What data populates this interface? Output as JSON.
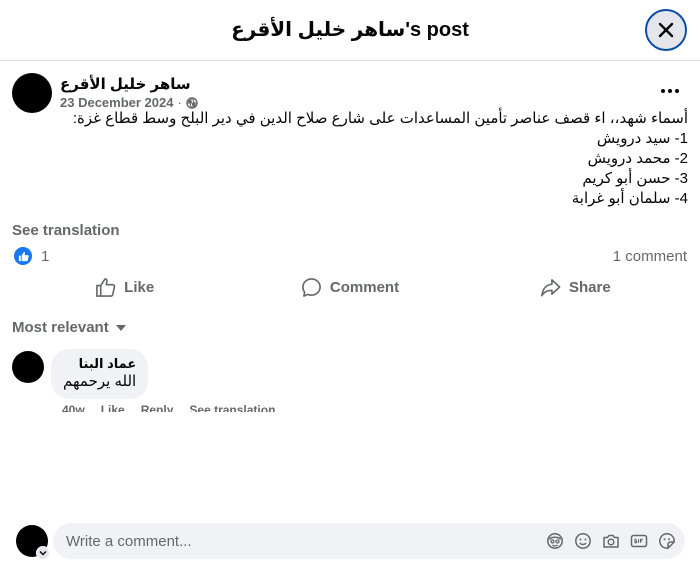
{
  "header": {
    "title": "ساهر خليل الأقرع's post"
  },
  "post": {
    "author": "ساهر خليل الأقرع",
    "date": "23 December 2024",
    "date_separator": "·",
    "audience_icon": "globe-icon",
    "body_lines": [
      "أسماء شهد،، اء قصف عناصر تأمين المساعدات على شارع صلاح الدين في دير البلح وسط قطاع غزة:",
      "1- سيد درويش",
      "2- محمد درويش",
      "3- حسن أبو كريم",
      "4- سلمان أبو غرابة"
    ],
    "see_translation": "See translation",
    "reaction_count": "1",
    "comment_count": "1 comment"
  },
  "actions": {
    "like": "Like",
    "comment": "Comment",
    "share": "Share"
  },
  "comments_section": {
    "sort_label": "Most relevant",
    "comments": [
      {
        "author": "عماد البنا",
        "text": "الله يرحمهم",
        "time": "40w",
        "like": "Like",
        "reply": "Reply",
        "see_translation": "See translation"
      }
    ]
  },
  "composer": {
    "placeholder": "Write a comment..."
  },
  "colors": {
    "brand_blue": "#1877f2",
    "secondary_text": "#65676b",
    "bubble_bg": "#f0f2f5"
  }
}
